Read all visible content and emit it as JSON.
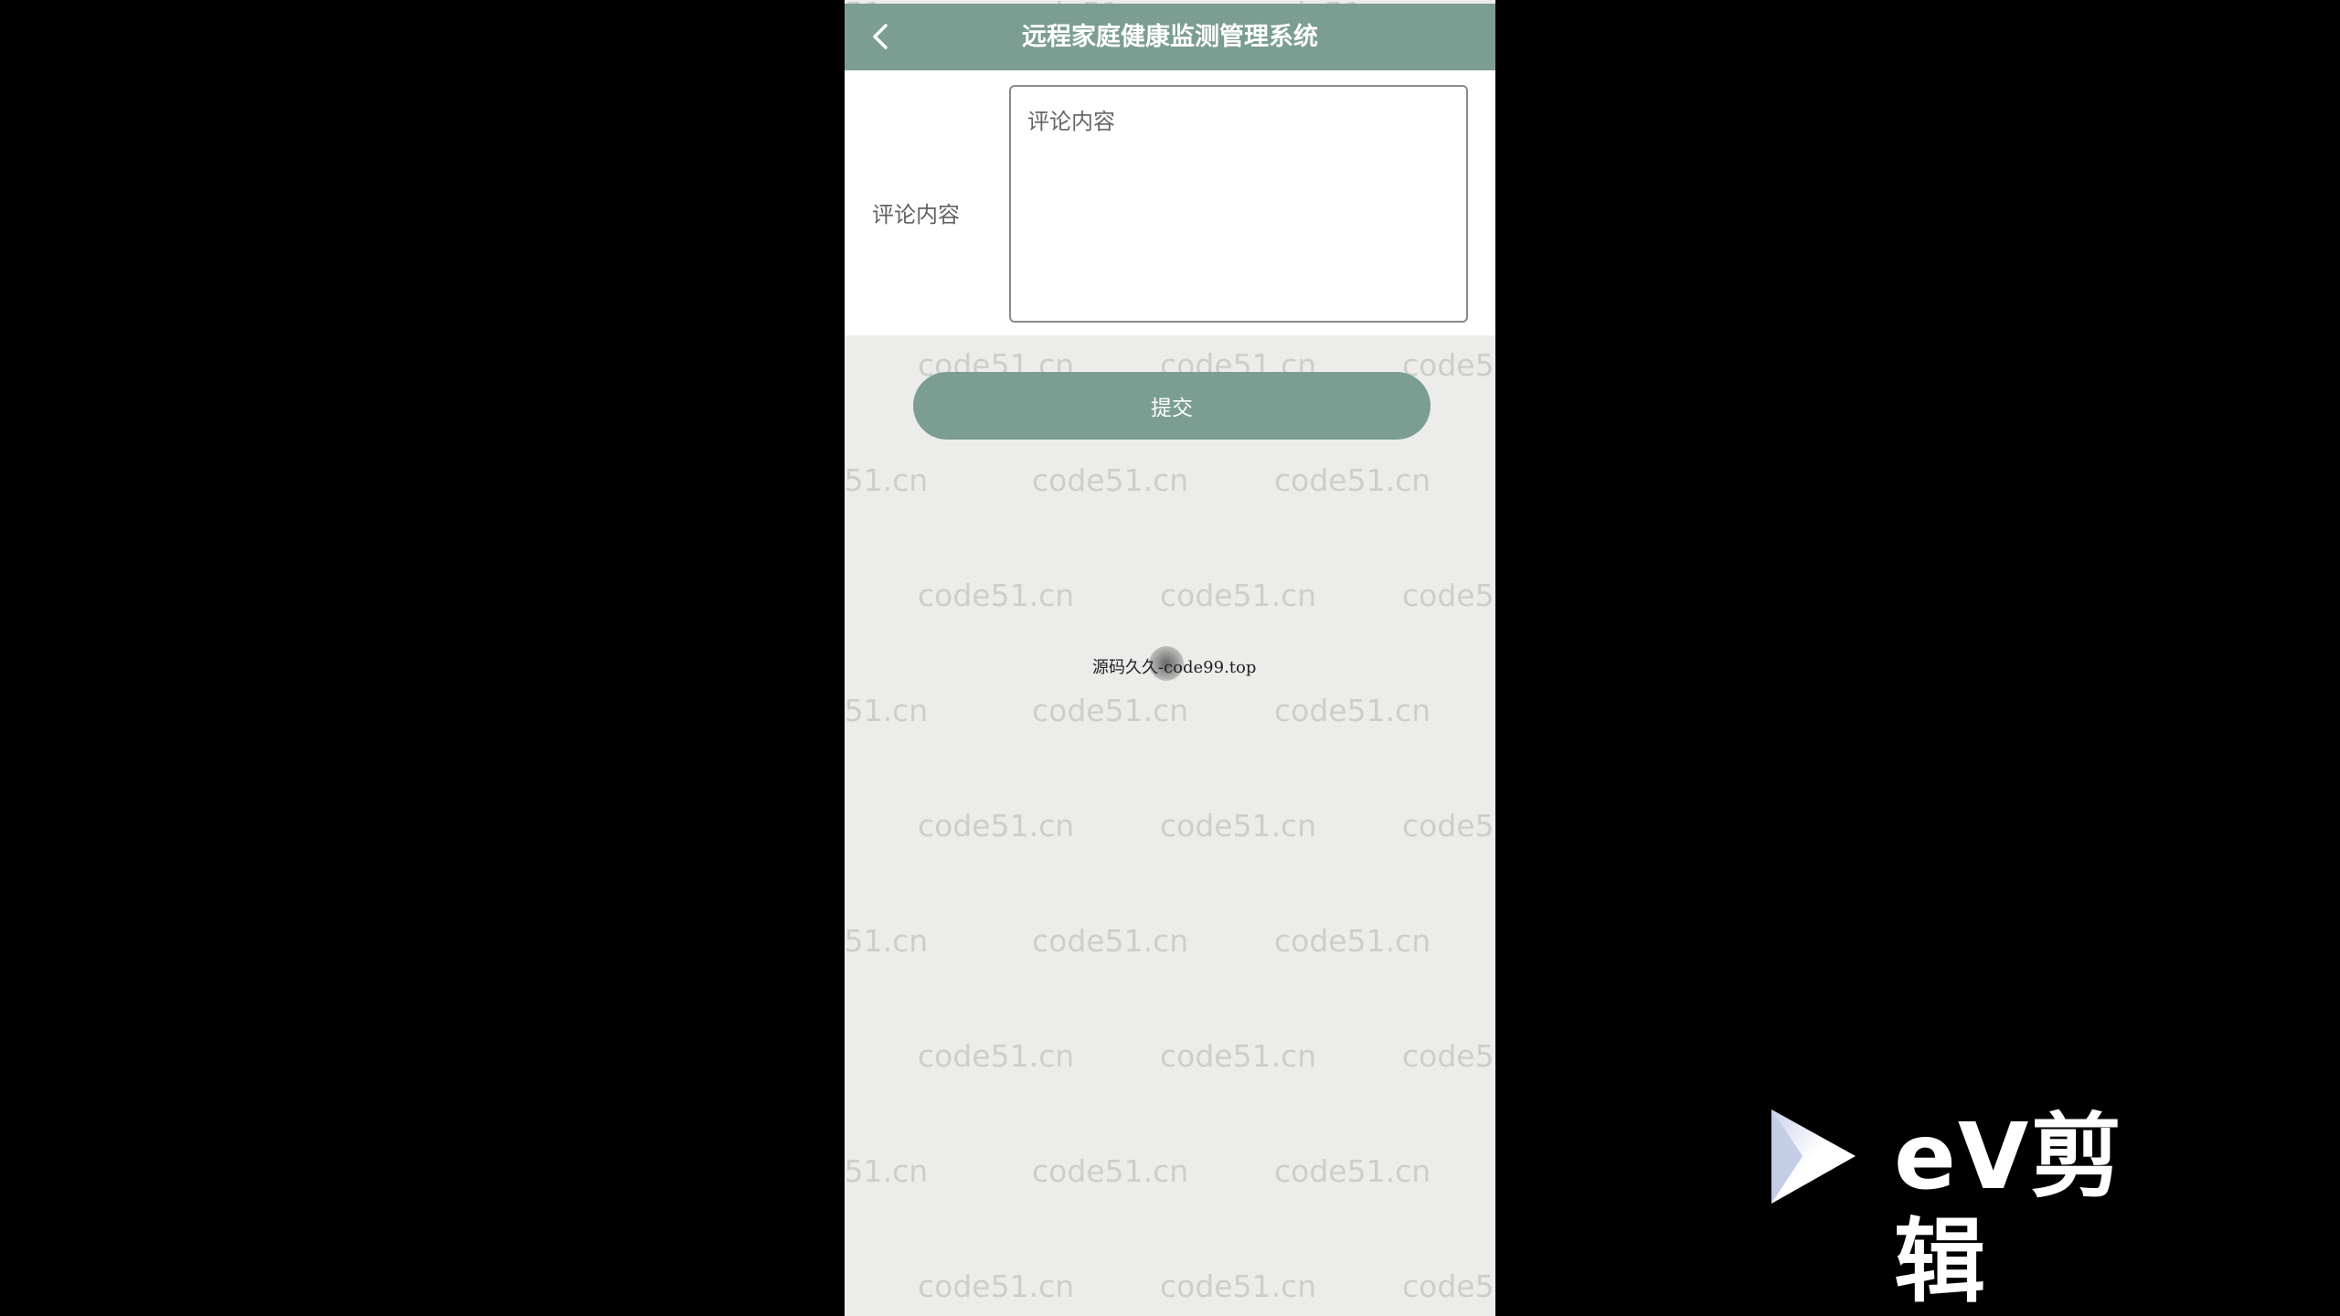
{
  "app": {
    "title": "远程家庭健康监测管理系统"
  },
  "form": {
    "comment_label": "评论内容",
    "comment_placeholder": "评论内容",
    "comment_value": ""
  },
  "actions": {
    "submit_label": "提交"
  },
  "overlay": {
    "watermark_text": "code51.cn",
    "caption": "源码久久-code99.top",
    "brand": "eV剪辑"
  },
  "colors": {
    "accent": "#7b9d92",
    "background": "#ececea",
    "letterbox": "#000000"
  },
  "icons": {
    "back": "chevron-left-icon",
    "brand_logo": "play-icon"
  }
}
